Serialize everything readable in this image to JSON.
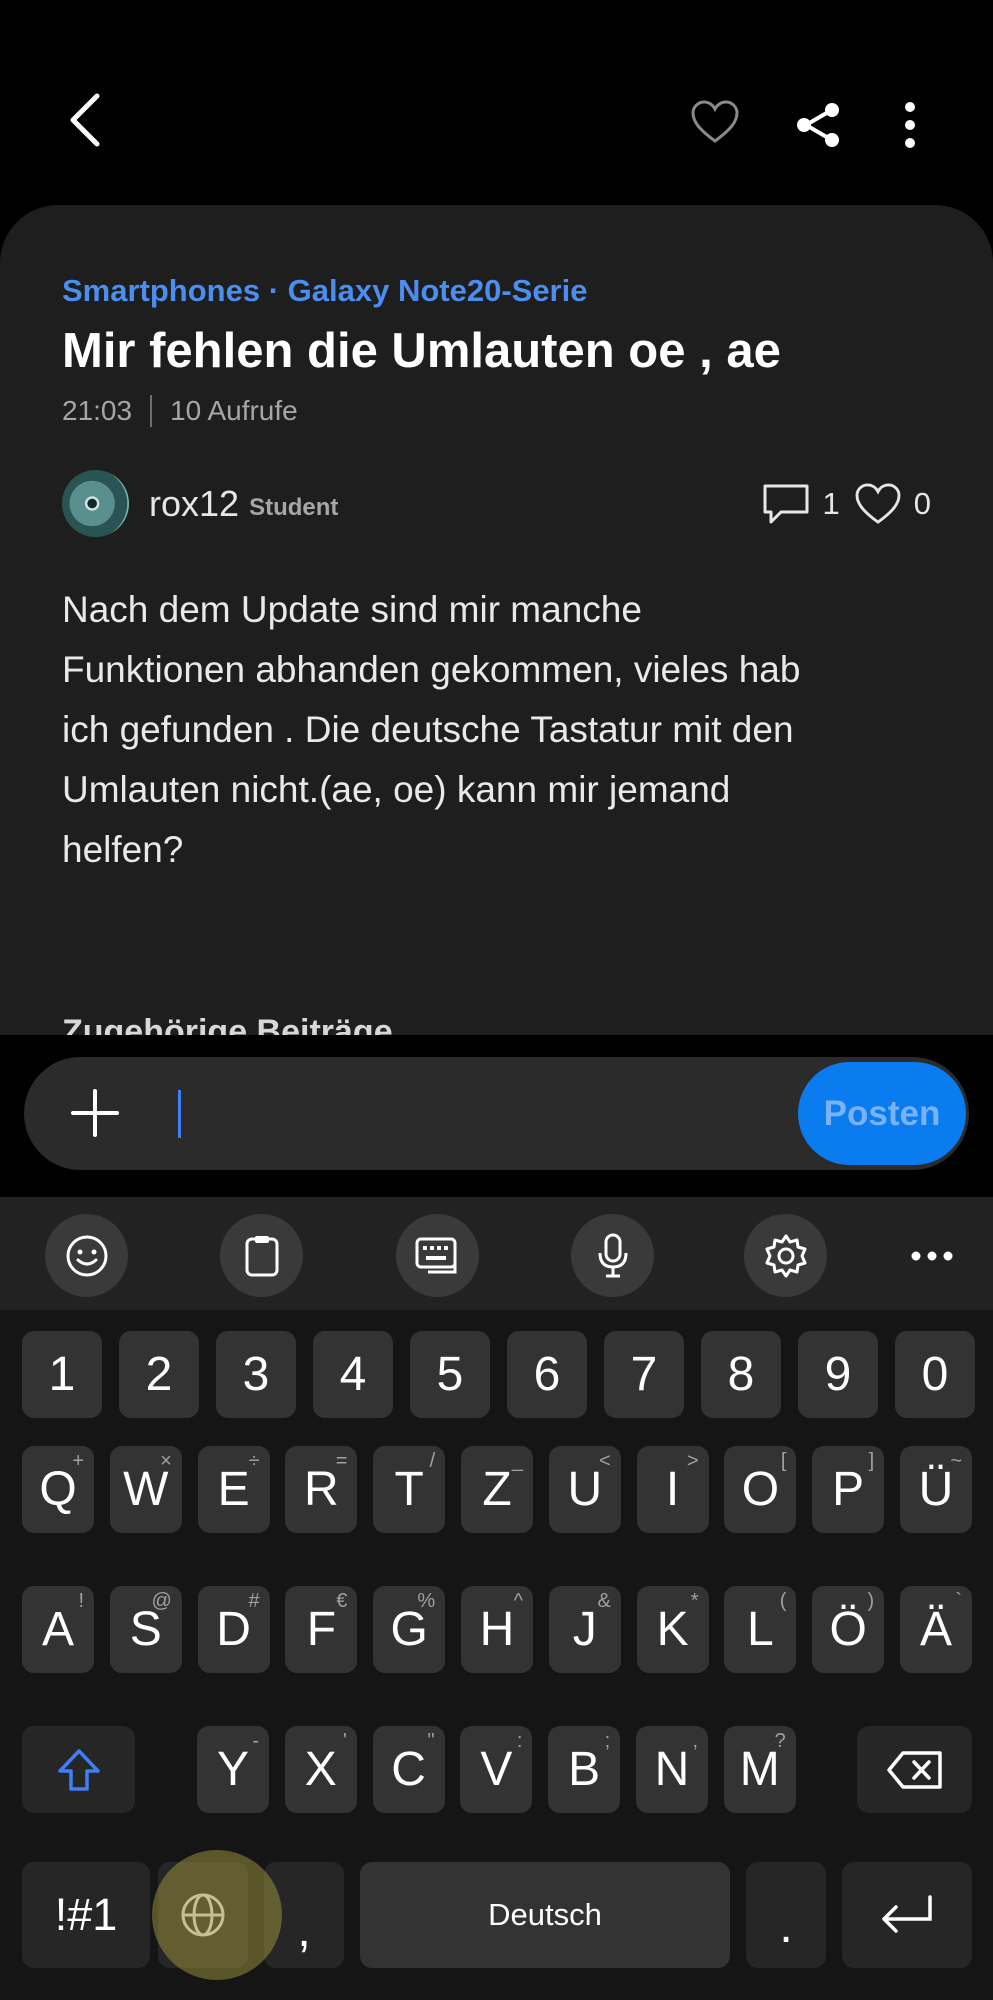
{
  "header": {
    "back_icon": "chevron-left-icon",
    "favorite_icon": "heart-outline-icon",
    "share_icon": "share-icon",
    "more_icon": "vertical-ellipsis-icon"
  },
  "post": {
    "breadcrumb": "Smartphones · Galaxy Note20-Serie",
    "title": "Mir fehlen die Umlauten oe , ae",
    "time": "21:03",
    "views": "10 Aufrufe",
    "author": {
      "name": "rox12",
      "role": "Student"
    },
    "comments_count": "1",
    "likes_count": "0",
    "body": "Nach  dem Update sind mir manche\nFunktionen  abhanden gekommen, vieles hab\nich gefunden . Die deutsche  Tastatur mit den\nUmlauten nicht.(ae, oe) kann mir jemand\nhelfen?",
    "related_heading": "Zugehörige Beiträge"
  },
  "composer": {
    "add_icon": "plus-icon",
    "input_value": "",
    "post_label": "Posten"
  },
  "keyboard": {
    "toolbar_icons": [
      "emoji-icon",
      "clipboard-icon",
      "keyboard-icon",
      "microphone-icon",
      "settings-icon",
      "more-horizontal-icon"
    ],
    "number_row": [
      "1",
      "2",
      "3",
      "4",
      "5",
      "6",
      "7",
      "8",
      "9",
      "0"
    ],
    "row1": [
      {
        "key": "Q",
        "sub": "+"
      },
      {
        "key": "W",
        "sub": "×"
      },
      {
        "key": "E",
        "sub": "÷"
      },
      {
        "key": "R",
        "sub": "="
      },
      {
        "key": "T",
        "sub": "/"
      },
      {
        "key": "Z",
        "sub": "_"
      },
      {
        "key": "U",
        "sub": "<"
      },
      {
        "key": "I",
        "sub": ">"
      },
      {
        "key": "O",
        "sub": "["
      },
      {
        "key": "P",
        "sub": "]"
      },
      {
        "key": "Ü",
        "sub": "~"
      }
    ],
    "row2": [
      {
        "key": "A",
        "sub": "!"
      },
      {
        "key": "S",
        "sub": "@"
      },
      {
        "key": "D",
        "sub": "#"
      },
      {
        "key": "F",
        "sub": "€"
      },
      {
        "key": "G",
        "sub": "%"
      },
      {
        "key": "H",
        "sub": "^"
      },
      {
        "key": "J",
        "sub": "&"
      },
      {
        "key": "K",
        "sub": "*"
      },
      {
        "key": "L",
        "sub": "("
      },
      {
        "key": "Ö",
        "sub": ")"
      },
      {
        "key": "Ä",
        "sub": "`"
      }
    ],
    "row3": [
      {
        "key": "Y",
        "sub": "-"
      },
      {
        "key": "X",
        "sub": "'"
      },
      {
        "key": "C",
        "sub": "\""
      },
      {
        "key": "V",
        "sub": ":"
      },
      {
        "key": "B",
        "sub": ";"
      },
      {
        "key": "N",
        "sub": ","
      },
      {
        "key": "M",
        "sub": "?"
      }
    ],
    "symbols_label": "!#1",
    "comma_label": ",",
    "space_label": "Deutsch",
    "period_label": ".",
    "shift_icon": "shift-icon",
    "backspace_icon": "backspace-icon",
    "language_icon": "globe-icon",
    "enter_icon": "enter-icon"
  }
}
